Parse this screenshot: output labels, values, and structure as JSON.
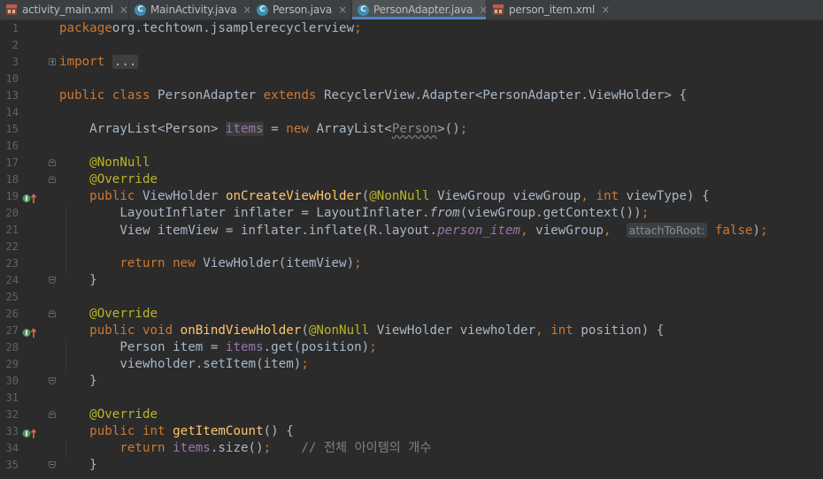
{
  "tabs": [
    {
      "label": "activity_main.xml",
      "icon": "xml-layout-icon",
      "active": false
    },
    {
      "label": "MainActivity.java",
      "icon": "java-class-icon",
      "active": false
    },
    {
      "label": "Person.java",
      "icon": "java-class-icon",
      "active": false
    },
    {
      "label": "PersonAdapter.java",
      "icon": "java-class-icon",
      "active": true
    },
    {
      "label": "person_item.xml",
      "icon": "xml-layout-icon",
      "active": false
    }
  ],
  "close_glyph": "×",
  "lines": [
    {
      "n": "1",
      "tokens": [
        [
          "kw",
          "package"
        ],
        [
          "",
          "org.techtown.jsamplerecyclerview"
        ],
        [
          "kw",
          ";"
        ]
      ]
    },
    {
      "n": "2",
      "tokens": []
    },
    {
      "n": "3",
      "tokens": [
        [
          "kw",
          "import "
        ],
        [
          "fold-box",
          "..."
        ]
      ],
      "fold": "plus"
    },
    {
      "n": "10",
      "tokens": []
    },
    {
      "n": "13",
      "tokens": [
        [
          "kw",
          "public class "
        ],
        [
          "",
          "PersonAdapter "
        ],
        [
          "kw",
          "extends "
        ],
        [
          "",
          "RecyclerView.Adapter<PersonAdapter.ViewHolder> {"
        ]
      ]
    },
    {
      "n": "14",
      "tokens": []
    },
    {
      "n": "15",
      "tokens": [
        [
          "",
          "    ArrayList<Person> "
        ],
        [
          "fld hl",
          "items"
        ],
        [
          "",
          " = "
        ],
        [
          "kw",
          "new "
        ],
        [
          "",
          "ArrayList<"
        ],
        [
          "dim",
          "Person"
        ],
        [
          "",
          ">()"
        ],
        [
          "kw",
          ";"
        ]
      ]
    },
    {
      "n": "16",
      "tokens": []
    },
    {
      "n": "17",
      "tokens": [
        [
          "an",
          "    @NonNull"
        ]
      ],
      "fold": "start"
    },
    {
      "n": "18",
      "tokens": [
        [
          "an",
          "    @Override"
        ]
      ],
      "fold": "start"
    },
    {
      "n": "19",
      "tokens": [
        [
          "kw",
          "    public "
        ],
        [
          "",
          "ViewHolder "
        ],
        [
          "fn",
          "onCreateViewHolder"
        ],
        [
          "",
          "("
        ],
        [
          "an",
          "@NonNull "
        ],
        [
          "",
          "ViewGroup viewGroup"
        ],
        [
          "kw",
          ", int "
        ],
        [
          "",
          "viewType) {"
        ]
      ],
      "gutter": "override"
    },
    {
      "n": "20",
      "tokens": [
        [
          "",
          "        LayoutInflater inflater = LayoutInflater."
        ],
        [
          "ita",
          "from"
        ],
        [
          "",
          "(viewGroup.getContext())"
        ],
        [
          "kw",
          ";"
        ]
      ]
    },
    {
      "n": "21",
      "tokens": [
        [
          "",
          "        View itemView = inflater.inflate(R.layout."
        ],
        [
          "fld ita",
          "person_item"
        ],
        [
          "kw",
          ", "
        ],
        [
          "",
          "viewGroup"
        ],
        [
          "kw",
          ", "
        ],
        [
          "hint",
          "attachToRoot:"
        ],
        [
          "kw",
          " false"
        ],
        [
          "",
          ")"
        ],
        [
          "kw",
          ";"
        ]
      ]
    },
    {
      "n": "22",
      "tokens": []
    },
    {
      "n": "23",
      "tokens": [
        [
          "kw",
          "        return new "
        ],
        [
          "",
          "ViewHolder(itemView)"
        ],
        [
          "kw",
          ";"
        ]
      ]
    },
    {
      "n": "24",
      "tokens": [
        [
          "",
          "    }"
        ]
      ],
      "fold": "end"
    },
    {
      "n": "25",
      "tokens": []
    },
    {
      "n": "26",
      "tokens": [
        [
          "an",
          "    @Override"
        ]
      ],
      "fold": "start"
    },
    {
      "n": "27",
      "tokens": [
        [
          "kw",
          "    public void "
        ],
        [
          "fn",
          "onBindViewHolder"
        ],
        [
          "",
          "("
        ],
        [
          "an",
          "@NonNull "
        ],
        [
          "",
          "ViewHolder viewholder"
        ],
        [
          "kw",
          ", int "
        ],
        [
          "",
          "position) {"
        ]
      ],
      "gutter": "override"
    },
    {
      "n": "28",
      "tokens": [
        [
          "",
          "        Person item = "
        ],
        [
          "fld",
          "items"
        ],
        [
          "",
          ".get(position)"
        ],
        [
          "kw",
          ";"
        ]
      ]
    },
    {
      "n": "29",
      "tokens": [
        [
          "",
          "        viewholder.setItem(item)"
        ],
        [
          "kw",
          ";"
        ]
      ]
    },
    {
      "n": "30",
      "tokens": [
        [
          "",
          "    }"
        ]
      ],
      "fold": "end"
    },
    {
      "n": "31",
      "tokens": []
    },
    {
      "n": "32",
      "tokens": [
        [
          "an",
          "    @Override"
        ]
      ],
      "fold": "start"
    },
    {
      "n": "33",
      "tokens": [
        [
          "kw",
          "    public int "
        ],
        [
          "fn",
          "getItemCount"
        ],
        [
          "",
          "() {"
        ]
      ],
      "gutter": "override"
    },
    {
      "n": "34",
      "tokens": [
        [
          "kw",
          "        return "
        ],
        [
          "fld",
          "items"
        ],
        [
          "",
          ".size()"
        ],
        [
          "kw",
          ";"
        ],
        [
          "cm",
          "    // 전체 아이템의 개수"
        ]
      ]
    },
    {
      "n": "35",
      "tokens": [
        [
          "",
          "    }"
        ]
      ],
      "fold": "end"
    }
  ]
}
